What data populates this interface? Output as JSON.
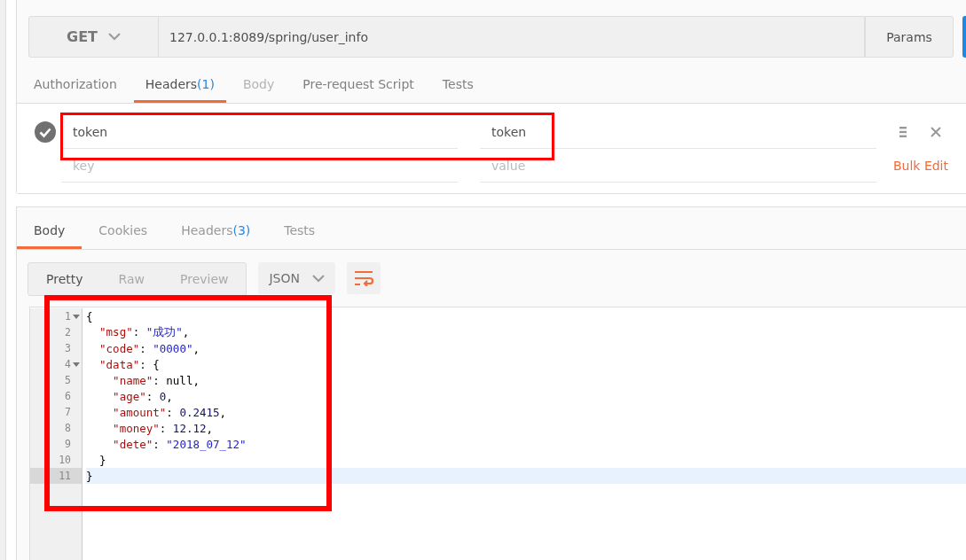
{
  "request": {
    "method": "GET",
    "url": "127.0.0.1:8089/spring/user_info",
    "params_button": "Params"
  },
  "request_tabs": [
    {
      "label": "Authorization",
      "selected": false,
      "disabled": false
    },
    {
      "label": "Headers",
      "count": "(1)",
      "selected": true,
      "disabled": false
    },
    {
      "label": "Body",
      "selected": false,
      "disabled": true
    },
    {
      "label": "Pre-request Script",
      "selected": false,
      "disabled": false
    },
    {
      "label": "Tests",
      "selected": false,
      "disabled": false
    }
  ],
  "headers": {
    "rows": [
      {
        "checked": true,
        "key": "token",
        "value": "token"
      }
    ],
    "key_placeholder": "key",
    "value_placeholder": "value",
    "bulk_edit": "Bulk Edit"
  },
  "response_tabs": [
    {
      "label": "Body",
      "selected": true
    },
    {
      "label": "Cookies",
      "selected": false
    },
    {
      "label": "Headers",
      "count": "(3)",
      "selected": false
    },
    {
      "label": "Tests",
      "selected": false
    }
  ],
  "view_modes": [
    {
      "label": "Pretty",
      "selected": true
    },
    {
      "label": "Raw",
      "selected": false
    },
    {
      "label": "Preview",
      "selected": false
    }
  ],
  "format": "JSON",
  "code_lines": [
    {
      "number": "1",
      "foldable": true,
      "active": false,
      "tokens": [
        {
          "text": "{",
          "kind": "punct"
        }
      ]
    },
    {
      "number": "2",
      "foldable": false,
      "active": false,
      "tokens": [
        {
          "text": "  \"msg\"",
          "kind": "key"
        },
        {
          "text": ": ",
          "kind": "punct"
        },
        {
          "text": "\"成功\"",
          "kind": "string"
        },
        {
          "text": ",",
          "kind": "punct"
        }
      ]
    },
    {
      "number": "3",
      "foldable": false,
      "active": false,
      "tokens": [
        {
          "text": "  \"code\"",
          "kind": "key"
        },
        {
          "text": ": ",
          "kind": "punct"
        },
        {
          "text": "\"0000\"",
          "kind": "string"
        },
        {
          "text": ",",
          "kind": "punct"
        }
      ]
    },
    {
      "number": "4",
      "foldable": true,
      "active": false,
      "tokens": [
        {
          "text": "  \"data\"",
          "kind": "key"
        },
        {
          "text": ": {",
          "kind": "punct"
        }
      ]
    },
    {
      "number": "5",
      "foldable": false,
      "active": false,
      "tokens": [
        {
          "text": "    \"name\"",
          "kind": "key"
        },
        {
          "text": ": null,",
          "kind": "punct"
        }
      ]
    },
    {
      "number": "6",
      "foldable": false,
      "active": false,
      "tokens": [
        {
          "text": "    \"age\"",
          "kind": "key"
        },
        {
          "text": ": ",
          "kind": "punct"
        },
        {
          "text": "0",
          "kind": "number"
        },
        {
          "text": ",",
          "kind": "punct"
        }
      ]
    },
    {
      "number": "7",
      "foldable": false,
      "active": false,
      "tokens": [
        {
          "text": "    \"amount\"",
          "kind": "key"
        },
        {
          "text": ": ",
          "kind": "punct"
        },
        {
          "text": "0.2415",
          "kind": "number"
        },
        {
          "text": ",",
          "kind": "punct"
        }
      ]
    },
    {
      "number": "8",
      "foldable": false,
      "active": false,
      "tokens": [
        {
          "text": "    \"money\"",
          "kind": "key"
        },
        {
          "text": ": ",
          "kind": "punct"
        },
        {
          "text": "12.12",
          "kind": "number"
        },
        {
          "text": ",",
          "kind": "punct"
        }
      ]
    },
    {
      "number": "9",
      "foldable": false,
      "active": false,
      "tokens": [
        {
          "text": "    \"dete\"",
          "kind": "key"
        },
        {
          "text": ": ",
          "kind": "punct"
        },
        {
          "text": "\"2018_07_12\"",
          "kind": "string"
        }
      ]
    },
    {
      "number": "10",
      "foldable": false,
      "active": false,
      "tokens": [
        {
          "text": "  }",
          "kind": "punct"
        }
      ]
    },
    {
      "number": "11",
      "foldable": false,
      "active": true,
      "tokens": [
        {
          "text": "}",
          "kind": "punct"
        }
      ]
    }
  ]
}
